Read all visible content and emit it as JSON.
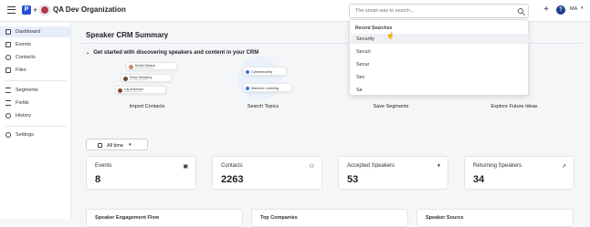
{
  "topbar": {
    "logo_letter": "P",
    "plus": "+",
    "org_name": "QA Dev Organization",
    "search_placeholder": "The smart way to search...",
    "add_label": "+",
    "help_label": "?",
    "user_initials": "MA",
    "user_chevron": "▾"
  },
  "sidebar": {
    "items": [
      {
        "label": "Dashboard",
        "icon": "dashboard-icon",
        "active": true
      },
      {
        "label": "Events",
        "icon": "calendar-icon"
      },
      {
        "label": "Contacts",
        "icon": "contacts-icon"
      },
      {
        "label": "Files",
        "icon": "files-icon"
      },
      {
        "label": "Segments",
        "icon": "segments-icon"
      },
      {
        "label": "Fields",
        "icon": "fields-icon"
      },
      {
        "label": "History",
        "icon": "history-icon"
      },
      {
        "label": "Settings",
        "icon": "settings-icon"
      }
    ]
  },
  "main": {
    "title": "Speaker CRM Summary",
    "getting_started": "Get started with discovering speakers and content in your CRM",
    "contacts_illustration": [
      "Emilie Watson",
      "Drew Hendarey",
      "Lily Anderson"
    ],
    "topics_illustration": [
      "Cybersecurity",
      "Machine Learning"
    ],
    "actions": [
      "Import Contacts",
      "Search Topics",
      "Save Segments",
      "Explore Future Ideas"
    ],
    "time_filter": "All time",
    "time_filter_chevron": "▾",
    "stats": [
      {
        "label": "Events",
        "value": "8",
        "icon": "calendar-icon",
        "glyph": "▣"
      },
      {
        "label": "Contacts",
        "value": "2263",
        "icon": "people-icon",
        "glyph": "⚇"
      },
      {
        "label": "Accepted Speakers",
        "value": "53",
        "icon": "microphone-icon",
        "glyph": "♦"
      },
      {
        "label": "Returning Speakers",
        "value": "34",
        "icon": "trend-up-icon",
        "glyph": "↗"
      }
    ],
    "lower_cards": [
      "Speaker Engagement Flow",
      "Top Companies",
      "Speaker Source"
    ]
  },
  "search_dropdown": {
    "header": "Recent Searches",
    "items": [
      "Security",
      "Securi",
      "Secur",
      "Sec",
      "Se"
    ]
  }
}
